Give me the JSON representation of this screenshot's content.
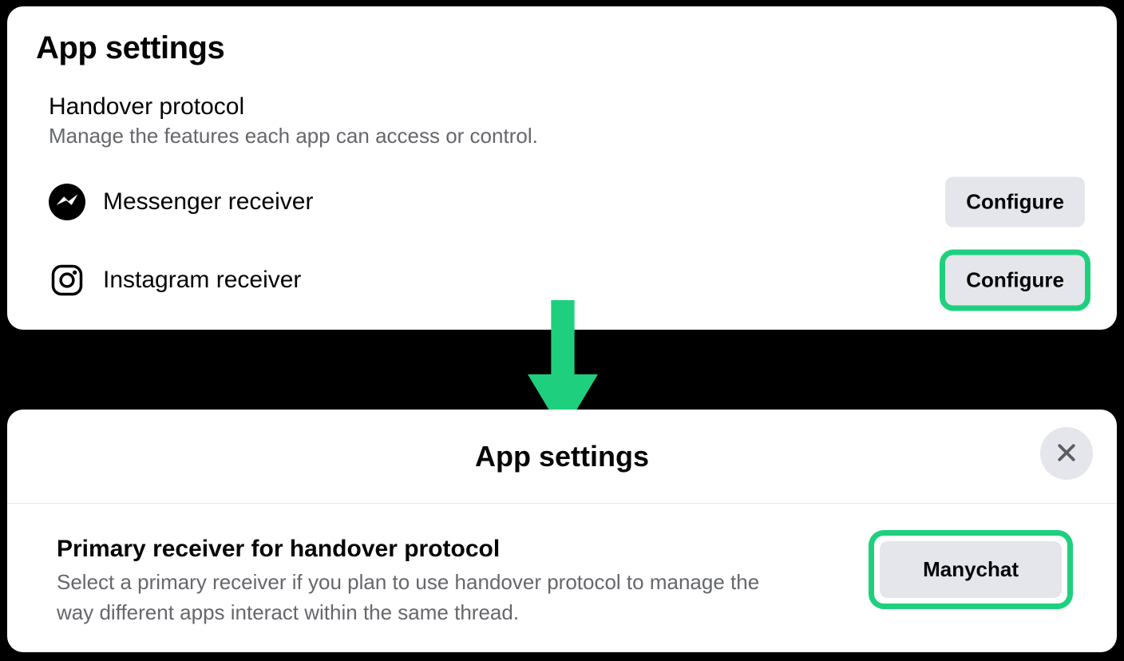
{
  "top": {
    "title": "App settings",
    "section_title": "Handover protocol",
    "section_subtitle": "Manage the features each app can access or control.",
    "rows": [
      {
        "label": "Messenger receiver",
        "button": "Configure"
      },
      {
        "label": "Instagram receiver",
        "button": "Configure"
      }
    ]
  },
  "arrow_color": "#1ed07e",
  "highlight_color": "#1ed07e",
  "modal": {
    "title": "App settings",
    "section_title": "Primary receiver for handover protocol",
    "section_subtitle": "Select a primary receiver if you plan to use handover protocol to manage the way different apps interact within the same thread.",
    "selected": "Manychat"
  }
}
